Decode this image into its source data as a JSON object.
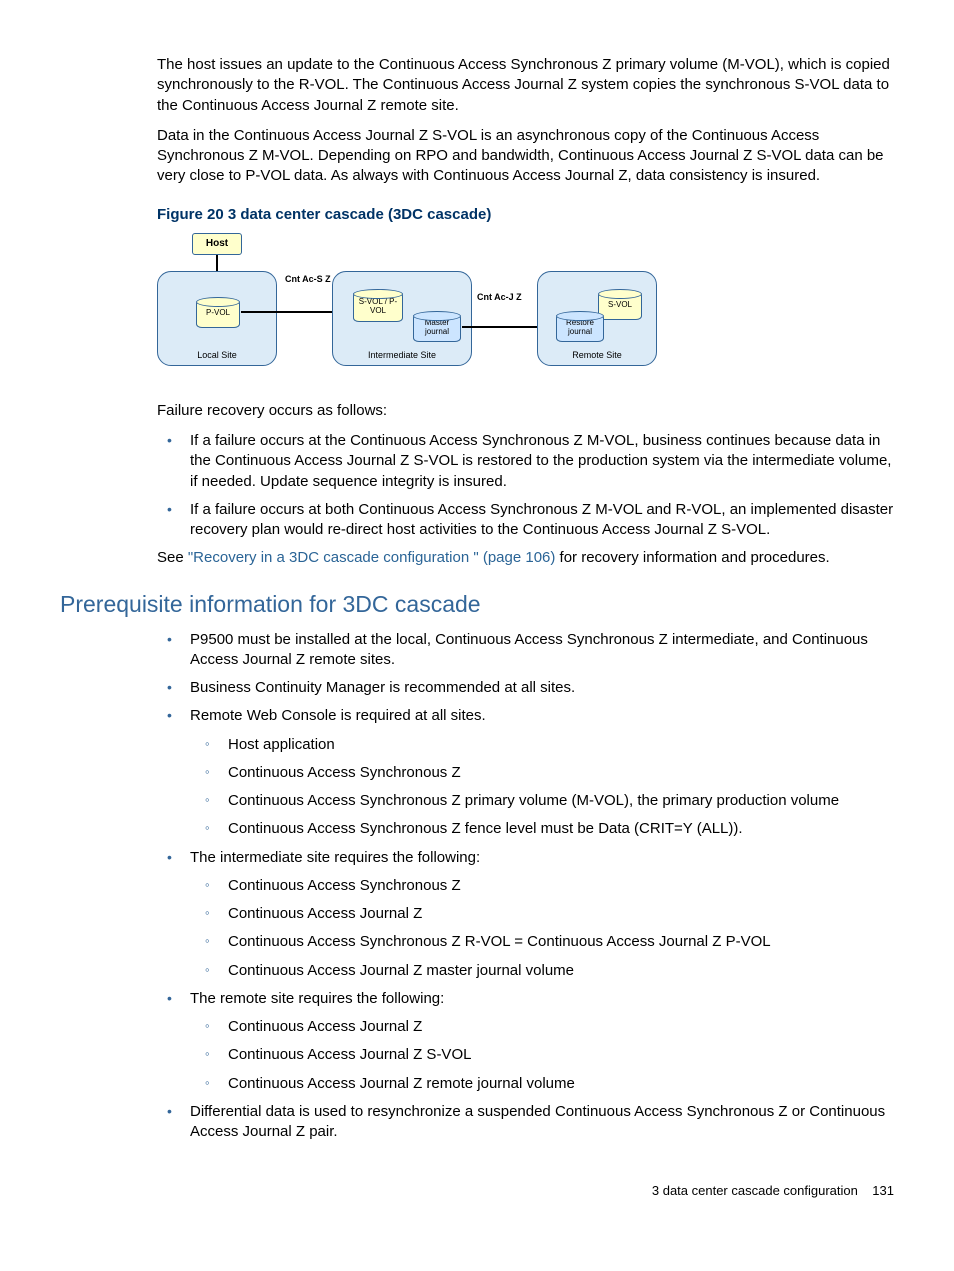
{
  "intro": {
    "p1": "The host issues an update to the Continuous Access Synchronous Z primary volume (M-VOL), which is copied synchronously to the R-VOL. The Continuous Access Journal Z system copies the synchronous S-VOL data to the Continuous Access Journal Z remote site.",
    "p2": "Data in the Continuous Access Journal Z S-VOL is an asynchronous copy of the Continuous Access Synchronous Z M-VOL. Depending on RPO and bandwidth, Continuous Access Journal Z S-VOL data can be very close to P-VOL data. As always with Continuous Access Journal Z, data consistency is insured."
  },
  "figure": {
    "caption": "Figure 20 3 data center cascade (3DC cascade)",
    "host": "Host",
    "local_label": "Local Site",
    "intermediate_label": "Intermediate Site",
    "remote_label": "Remote Site",
    "pvol": "P-VOL",
    "svol_pvol": "S-VOL / P-VOL",
    "master_journal": "Master journal",
    "svol": "S-VOL",
    "restore_journal": "Restore journal",
    "cnt_ac_s": "Cnt Ac-S Z",
    "cnt_ac_j": "Cnt Ac-J Z"
  },
  "failure": {
    "intro": "Failure recovery occurs as follows:",
    "b1": "If a failure occurs at the Continuous Access Synchronous Z M-VOL, business continues because data in the Continuous Access Journal Z S-VOL is restored to the production system via the intermediate volume, if needed. Update sequence integrity is insured.",
    "b2": "If a failure occurs at both Continuous Access Synchronous Z M-VOL and R-VOL, an implemented disaster recovery plan would re-direct host activities to the Continuous Access Journal Z S-VOL.",
    "see_pre": "See ",
    "see_link": "\"Recovery in a 3DC cascade configuration \" (page 106)",
    "see_post": " for recovery information and procedures."
  },
  "prereq": {
    "heading": "Prerequisite information for 3DC cascade",
    "items": [
      "P9500 must be installed at the local, Continuous Access Synchronous Z intermediate, and Continuous Access Journal Z remote sites.",
      "Business Continuity Manager is recommended at all sites.",
      "Remote Web Console is required at all sites.",
      "The intermediate site requires the following:",
      "The remote site requires the following:",
      "Differential data is used to resynchronize a suspended Continuous Access Synchronous Z or Continuous Access Journal Z pair."
    ],
    "sub_rwc": [
      "Host application",
      "Continuous Access Synchronous Z",
      "Continuous Access Synchronous Z primary volume (M-VOL), the primary production volume",
      "Continuous Access Synchronous Z fence level must be Data (CRIT=Y (ALL))."
    ],
    "sub_intermediate": [
      "Continuous Access Synchronous Z",
      "Continuous Access Journal Z",
      "Continuous Access Synchronous Z R-VOL = Continuous Access Journal Z P-VOL",
      "Continuous Access Journal Z master journal volume"
    ],
    "sub_remote": [
      "Continuous Access Journal Z",
      "Continuous Access Journal Z S-VOL",
      "Continuous Access Journal Z remote journal volume"
    ]
  },
  "footer": {
    "text": "3 data center cascade configuration",
    "page": "131"
  }
}
